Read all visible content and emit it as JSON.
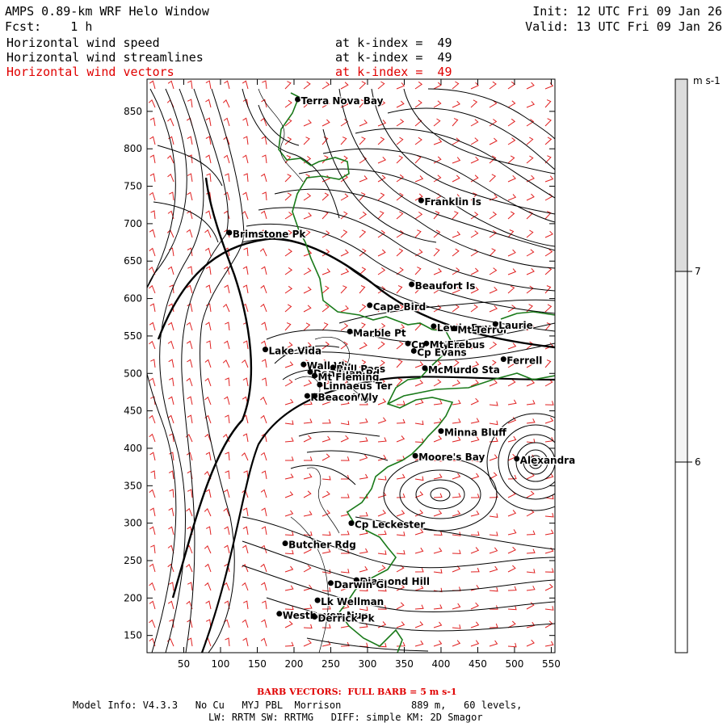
{
  "header": {
    "title": "AMPS 0.89-km WRF Helo Window",
    "fcst_label": "Fcst:",
    "fcst_value": "1 h",
    "init": "Init: 12 UTC Fri 09 Jan 26",
    "valid": "Valid: 13 UTC Fri 09 Jan 26",
    "fields": [
      {
        "name": "Horizontal wind speed",
        "level": "at k-index =  49"
      },
      {
        "name": "Horizontal wind streamlines",
        "level": "at k-index =  49"
      },
      {
        "name": "Horizontal wind vectors",
        "level": "at k-index =  49"
      }
    ]
  },
  "map": {
    "x_ticks": [
      50,
      100,
      150,
      200,
      250,
      300,
      350,
      400,
      450,
      500,
      550
    ],
    "y_ticks": [
      150,
      200,
      250,
      300,
      350,
      400,
      450,
      500,
      550,
      600,
      650,
      700,
      750,
      800,
      850
    ],
    "xlim": [
      0,
      555
    ],
    "ylim": [
      127,
      893
    ],
    "stations": [
      {
        "name": "Terra Nova Bay",
        "x": 205,
        "y": 866
      },
      {
        "name": "Franklin Is",
        "x": 373,
        "y": 731
      },
      {
        "name": "Brimstone Pk",
        "x": 112,
        "y": 688
      },
      {
        "name": "Beaufort Is",
        "x": 360,
        "y": 619
      },
      {
        "name": "Cape Bird",
        "x": 303,
        "y": 591
      },
      {
        "name": "Lewis Bay",
        "x": 390,
        "y": 563
      },
      {
        "name": "Mt Terror",
        "x": 418,
        "y": 560
      },
      {
        "name": "Laurie",
        "x": 474,
        "y": 566
      },
      {
        "name": "Marble Pt",
        "x": 276,
        "y": 556
      },
      {
        "name": "Cp Royds",
        "x": 355,
        "y": 540
      },
      {
        "name": "Mt Erebus",
        "x": 380,
        "y": 540
      },
      {
        "name": "Lake Vida",
        "x": 161,
        "y": 532
      },
      {
        "name": "Cp Evans",
        "x": 363,
        "y": 530
      },
      {
        "name": "Wall Vly",
        "x": 213,
        "y": 512
      },
      {
        "name": "Bull Pass",
        "x": 253,
        "y": 508
      },
      {
        "name": "McMurdo Sta",
        "x": 378,
        "y": 507
      },
      {
        "name": "Ferrell",
        "x": 485,
        "y": 519
      },
      {
        "name": "Don Juan Pd",
        "x": 222,
        "y": 502
      },
      {
        "name": "Mt Fleming",
        "x": 228,
        "y": 497
      },
      {
        "name": "Linnaeus Ter",
        "x": 235,
        "y": 485
      },
      {
        "name": "Kennar Vly",
        "x": 218,
        "y": 470
      },
      {
        "name": "Beacon Vly",
        "x": 228,
        "y": 470
      },
      {
        "name": "Minna Bluff",
        "x": 400,
        "y": 423
      },
      {
        "name": "Moore's Bay",
        "x": 365,
        "y": 390
      },
      {
        "name": "Alexandra",
        "x": 503,
        "y": 386
      },
      {
        "name": "Cp Leckester",
        "x": 278,
        "y": 300
      },
      {
        "name": "Butcher Rdg",
        "x": 188,
        "y": 273
      },
      {
        "name": "Diamond Hill",
        "x": 285,
        "y": 224
      },
      {
        "name": "Darwin Gl",
        "x": 250,
        "y": 220
      },
      {
        "name": "Lk Wellman",
        "x": 232,
        "y": 197
      },
      {
        "name": "Westhaven Nun",
        "x": 180,
        "y": 179
      },
      {
        "name": "Derrick Pk",
        "x": 228,
        "y": 175
      }
    ]
  },
  "colorbar": {
    "unit": "m s-1",
    "labels": [
      "7",
      "6"
    ]
  },
  "footer": {
    "barb": "BARB VECTORS:  FULL BARB = 5 m s-1",
    "model_info": "Model Info: V4.3.3   No Cu   MYJ PBL  Morrison            889 m,   60 levels,",
    "model_info2": "LW: RRTM SW: RRTMG   DIFF: simple KM: 2D Smagor"
  }
}
